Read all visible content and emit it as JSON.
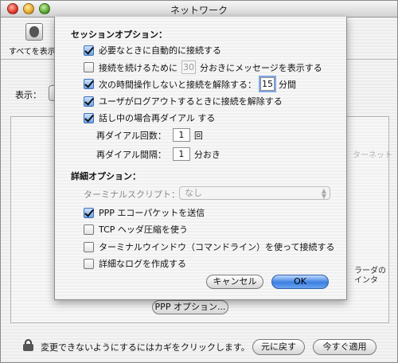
{
  "window": {
    "title": "ネットワーク"
  },
  "toolbar": {
    "show_all_label": "すべてを表示"
  },
  "main": {
    "show_label": "表示：",
    "ppp_options_button": "PPP オプション..."
  },
  "background_text": {
    "partial_server": "ターネット",
    "partial_prefs": "ラーダの",
    "partial_interface": "インタ"
  },
  "footer": {
    "lock_text": "変更できないようにするにはカギをクリックします。",
    "revert_button": "元に戻す",
    "apply_button": "今すぐ適用"
  },
  "sheet": {
    "session_title": "セッションオプション：",
    "options": {
      "auto_connect": {
        "label": "必要なときに自動的に接続する",
        "checked": true
      },
      "remind": {
        "label_before": "接続を続けるために",
        "value": "30",
        "label_after": "分おきにメッセージを表示する",
        "checked": false
      },
      "idle_disconnect": {
        "label_before": "次の時間操作しないと接続を解除する：",
        "value": "15",
        "label_after": "分間",
        "checked": true
      },
      "logout_disconnect": {
        "label": "ユーザがログアウトするときに接続を解除する",
        "checked": true
      },
      "redial": {
        "label": "話し中の場合再ダイアル する",
        "checked": true
      }
    },
    "redial_count": {
      "label": "再ダイアル回数：",
      "value": "1",
      "unit": "回"
    },
    "redial_interval": {
      "label": "再ダイアル間隔：",
      "value": "1",
      "unit": "分おき"
    },
    "advanced_title": "詳細オプション：",
    "terminal_script": {
      "label": "ターミナルスクリプト：",
      "value": "なし"
    },
    "advanced": {
      "ppp_echo": {
        "label": "PPP エコーパケットを送信",
        "checked": true
      },
      "tcp_compression": {
        "label": "TCP ヘッダ圧縮を使う",
        "checked": false
      },
      "terminal_window": {
        "label": "ターミナルウインドウ（コマンドライン）を使って接続する",
        "checked": false
      },
      "verbose_log": {
        "label": "詳細なログを作成する",
        "checked": false
      }
    },
    "cancel_button": "キャンセル",
    "ok_button": "OK"
  }
}
